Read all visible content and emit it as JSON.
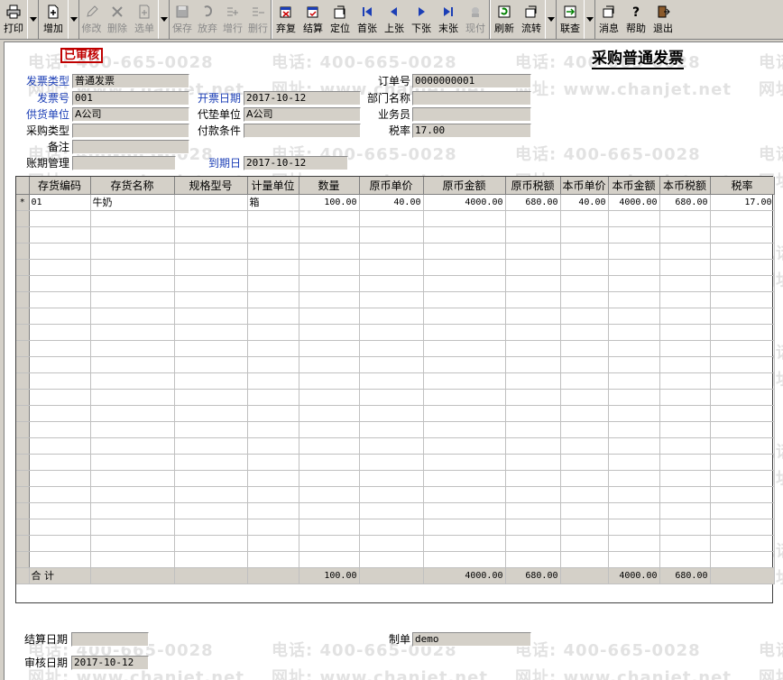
{
  "toolbar": {
    "buttons": [
      {
        "label": "打印",
        "icon": "printer-icon",
        "enabled": true
      },
      {
        "label": "增加",
        "icon": "add-document-icon",
        "enabled": true
      },
      {
        "label": "修改",
        "icon": "edit-icon",
        "enabled": false
      },
      {
        "label": "删除",
        "icon": "delete-icon",
        "enabled": false
      },
      {
        "label": "选单",
        "icon": "select-bill-icon",
        "enabled": false
      },
      {
        "label": "保存",
        "icon": "save-icon",
        "enabled": false
      },
      {
        "label": "放弃",
        "icon": "discard-icon",
        "enabled": false
      },
      {
        "label": "增行",
        "icon": "add-row-icon",
        "enabled": false
      },
      {
        "label": "删行",
        "icon": "delete-row-icon",
        "enabled": false
      },
      {
        "label": "弃复",
        "icon": "unapprove-icon",
        "enabled": true
      },
      {
        "label": "结算",
        "icon": "settle-icon",
        "enabled": true
      },
      {
        "label": "定位",
        "icon": "locate-icon",
        "enabled": true
      },
      {
        "label": "首张",
        "icon": "first-record-icon",
        "enabled": true
      },
      {
        "label": "上张",
        "icon": "previous-record-icon",
        "enabled": true
      },
      {
        "label": "下张",
        "icon": "next-record-icon",
        "enabled": true
      },
      {
        "label": "末张",
        "icon": "last-record-icon",
        "enabled": true
      },
      {
        "label": "现付",
        "icon": "cash-pay-icon",
        "enabled": false
      },
      {
        "label": "刷新",
        "icon": "refresh-icon",
        "enabled": true
      },
      {
        "label": "流转",
        "icon": "flow-icon",
        "enabled": true
      },
      {
        "label": "联查",
        "icon": "linked-query-icon",
        "enabled": true
      },
      {
        "label": "消息",
        "icon": "message-icon",
        "enabled": true
      },
      {
        "label": "帮助",
        "icon": "help-icon",
        "enabled": true
      },
      {
        "label": "退出",
        "icon": "exit-icon",
        "enabled": true
      }
    ]
  },
  "status_stamp": "已审核",
  "doc_title": "采购普通发票",
  "header": {
    "invoice_type_label": "发票类型",
    "invoice_type": "普通发票",
    "invoice_no_label": "发票号",
    "invoice_no": "001",
    "supplier_label": "供货单位",
    "supplier": "A公司",
    "purchase_type_label": "采购类型",
    "purchase_type": "",
    "remark_label": "备注",
    "remark": "",
    "period_label": "账期管理",
    "period": "",
    "invoice_date_label": "开票日期",
    "invoice_date": "2017-10-12",
    "advance_unit_label": "代垫单位",
    "advance_unit": "A公司",
    "payment_terms_label": "付款条件",
    "payment_terms": "",
    "due_date_label": "到期日",
    "due_date": "2017-10-12",
    "order_no_label": "订单号",
    "order_no": "0000000001",
    "department_label": "部门名称",
    "department": "",
    "salesman_label": "业务员",
    "salesman": "",
    "tax_rate_label": "税率",
    "tax_rate": "17.00"
  },
  "grid": {
    "columns": [
      "存货编码",
      "存货名称",
      "规格型号",
      "计量单位",
      "数量",
      "原币单价",
      "原币金额",
      "原币税额",
      "本币单价",
      "本币金额",
      "本币税额",
      "税率"
    ],
    "rows": [
      {
        "marker": "*",
        "code": "01",
        "name": "牛奶",
        "spec": "",
        "unit": "箱",
        "qty": "100.00",
        "orig_price": "40.00",
        "orig_amount": "4000.00",
        "orig_tax": "680.00",
        "local_price": "40.00",
        "local_amount": "4000.00",
        "local_tax": "680.00",
        "tax_rate": "17.00"
      }
    ],
    "total": {
      "label": "合  计",
      "qty": "100.00",
      "orig_amount": "4000.00",
      "orig_tax": "680.00",
      "local_amount": "4000.00",
      "local_tax": "680.00"
    }
  },
  "footer": {
    "settle_date_label": "结算日期",
    "settle_date": "",
    "maker_label": "制单",
    "maker": "demo",
    "audit_date_label": "审核日期",
    "audit_date": "2017-10-12"
  },
  "watermark": {
    "phone": "电话: 400-665-0028",
    "site": "网址: www.chanjet.net"
  }
}
